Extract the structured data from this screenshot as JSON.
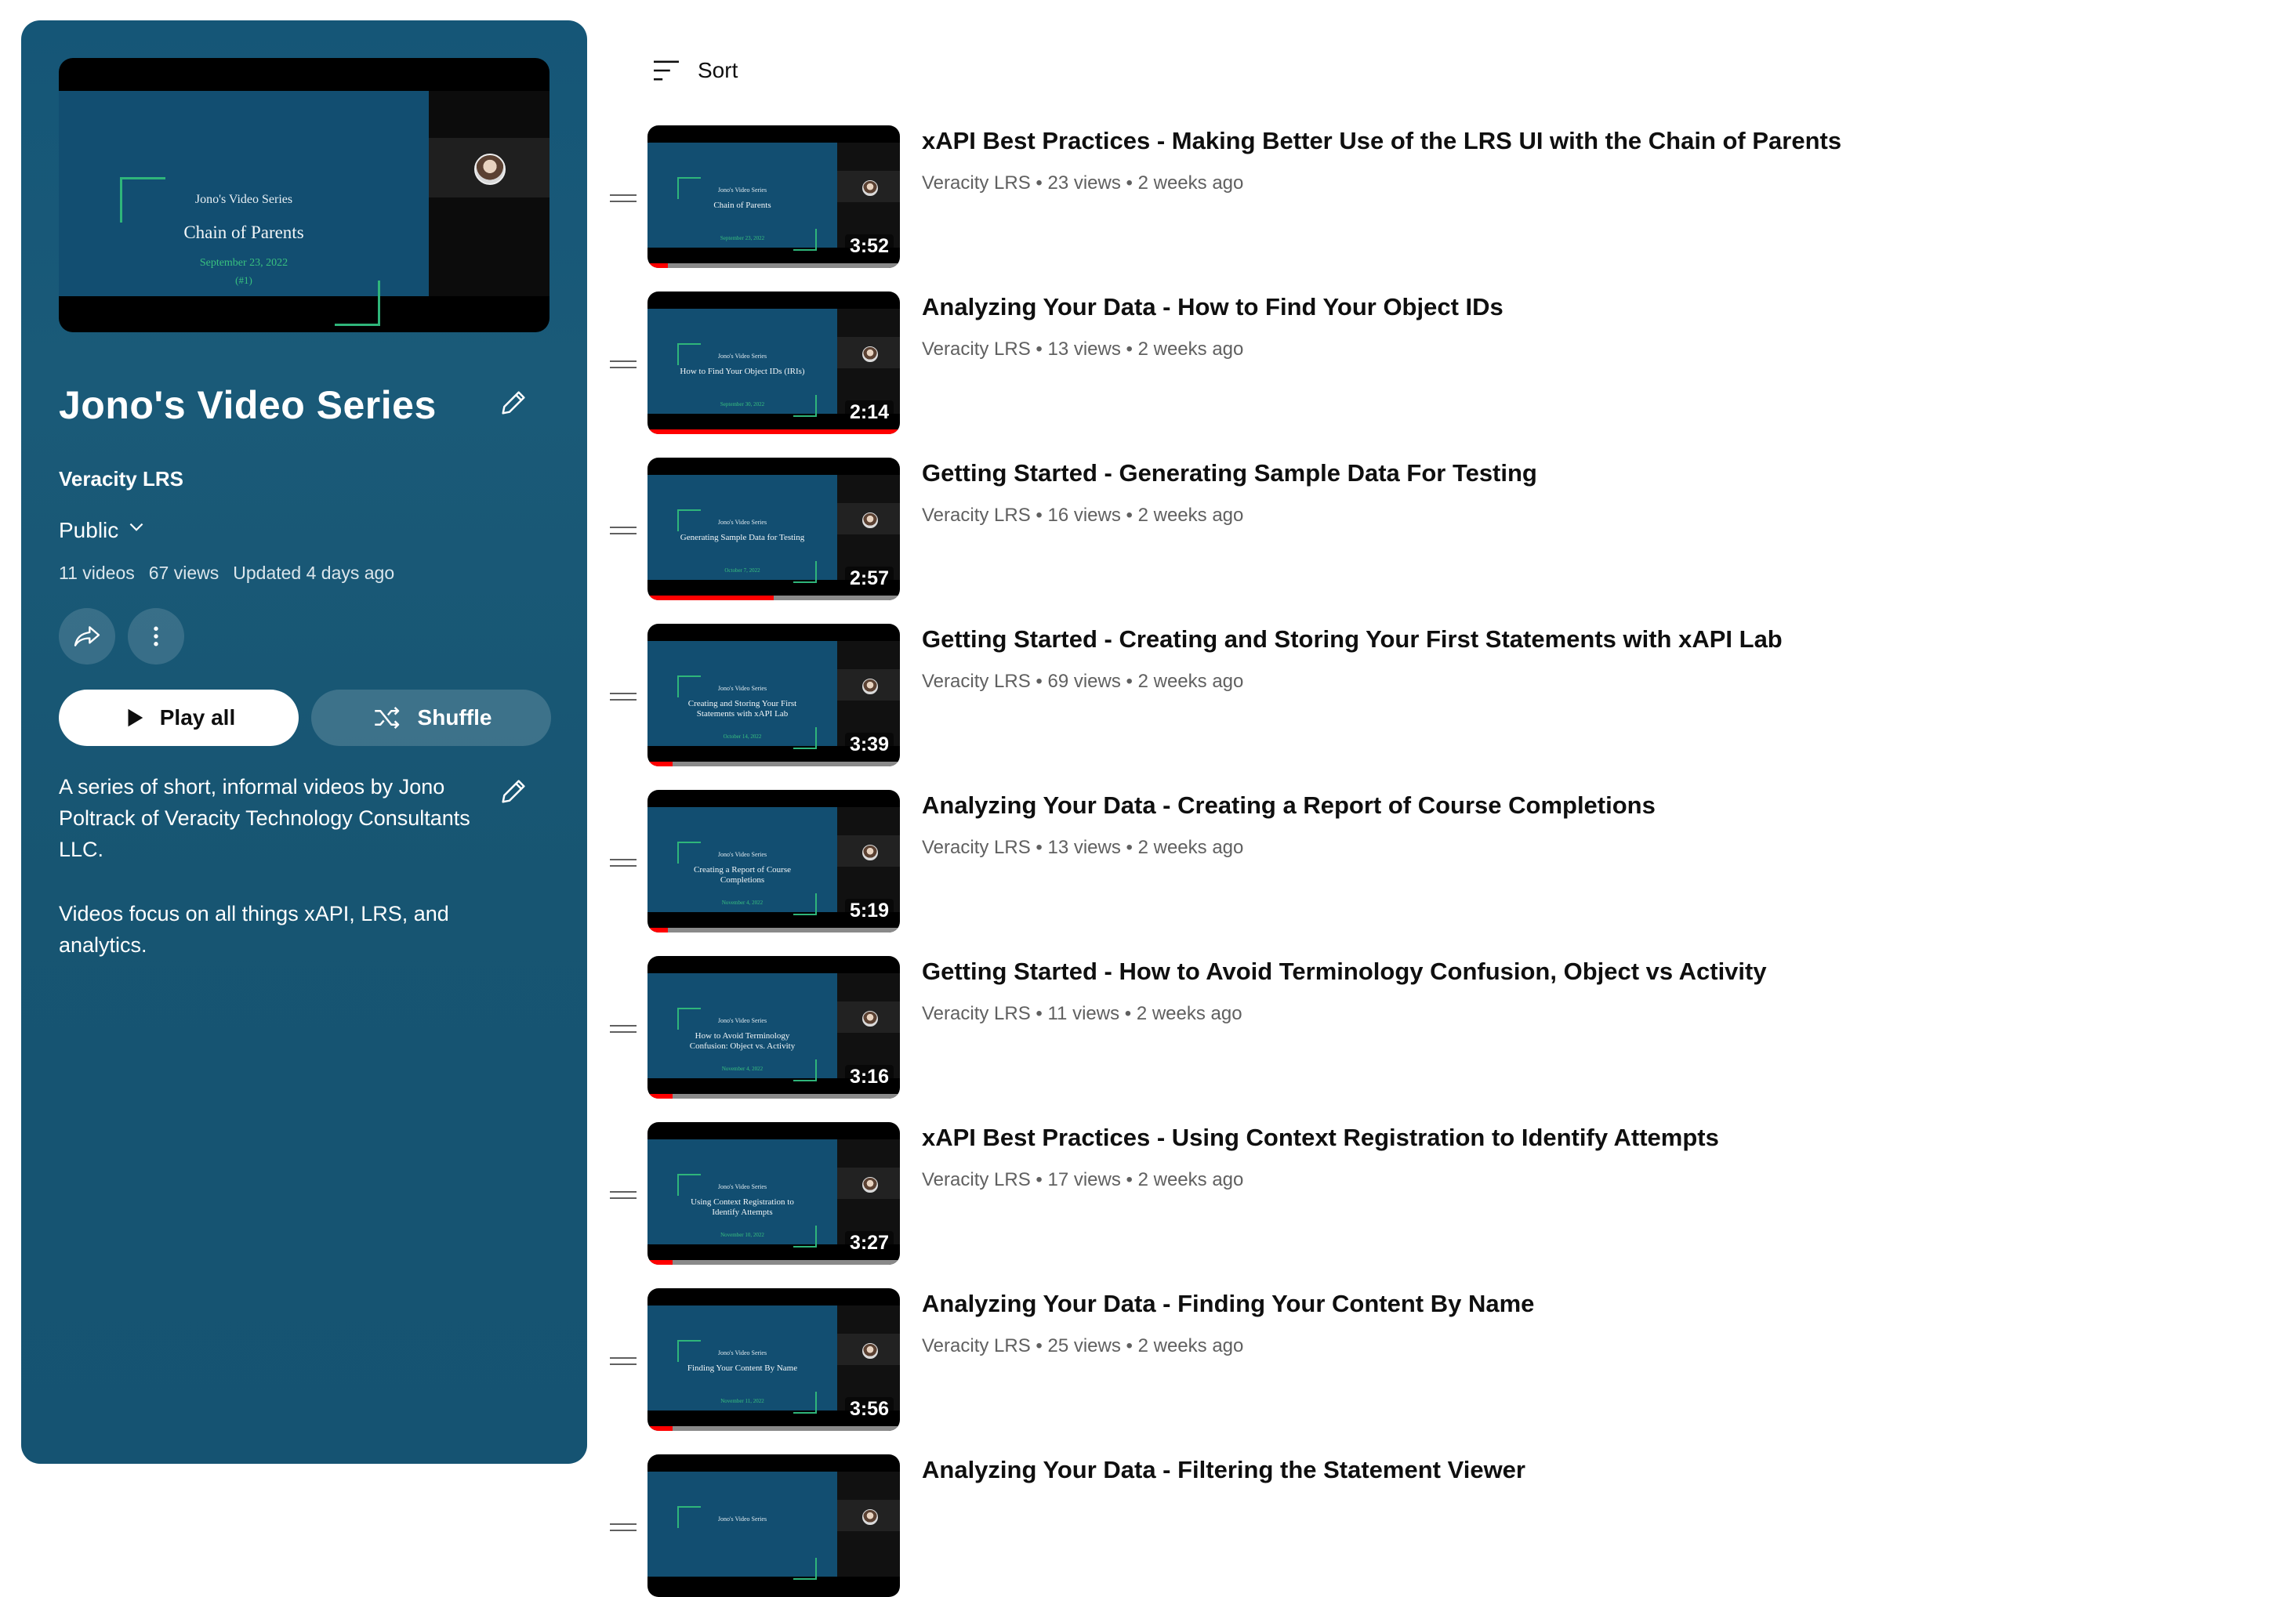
{
  "playlist": {
    "hero": {
      "series": "Jono's Video Series",
      "topic": "Chain of Parents",
      "date": "September 23, 2022",
      "number": "(#1)"
    },
    "title": "Jono's Video Series",
    "channel": "Veracity LRS",
    "privacy": "Public",
    "video_count": "11 videos",
    "views": "67 views",
    "updated": "Updated 4 days ago",
    "play_all_label": "Play all",
    "shuffle_label": "Shuffle",
    "description_1": "A series of short, informal videos by Jono Poltrack of Veracity Technology Consultants LLC.",
    "description_2": "Videos focus on all things xAPI, LRS, and analytics."
  },
  "sort_label": "Sort",
  "thumb_series": "Jono's Video Series",
  "videos": [
    {
      "title": "xAPI Best Practices - Making Better Use of the LRS UI with the Chain of Parents",
      "channel": "Veracity LRS",
      "views": "23 views",
      "age": "2 weeks ago",
      "duration": "3:52",
      "thumb_topic": "Chain of Parents",
      "thumb_date": "September 23, 2022",
      "progress": 0.08
    },
    {
      "title": "Analyzing Your Data - How to Find Your Object IDs",
      "channel": "Veracity LRS",
      "views": "13 views",
      "age": "2 weeks ago",
      "duration": "2:14",
      "thumb_topic": "How to Find Your Object IDs (IRIs)",
      "thumb_date": "September 30, 2022",
      "progress": 1.0
    },
    {
      "title": "Getting Started - Generating Sample Data For Testing",
      "channel": "Veracity LRS",
      "views": "16 views",
      "age": "2 weeks ago",
      "duration": "2:57",
      "thumb_topic": "Generating Sample Data for Testing",
      "thumb_date": "October 7, 2022",
      "progress": 0.5
    },
    {
      "title": "Getting Started - Creating and Storing Your First Statements with xAPI Lab",
      "channel": "Veracity LRS",
      "views": "69 views",
      "age": "2 weeks ago",
      "duration": "3:39",
      "thumb_topic": "Creating and Storing Your First Statements with xAPI Lab",
      "thumb_date": "October 14, 2022",
      "progress": 0.1
    },
    {
      "title": "Analyzing Your Data - Creating a Report of Course Completions",
      "channel": "Veracity LRS",
      "views": "13 views",
      "age": "2 weeks ago",
      "duration": "5:19",
      "thumb_topic": "Creating a Report of Course Completions",
      "thumb_date": "November 4, 2022",
      "progress": 0.08
    },
    {
      "title": "Getting Started - How to Avoid Terminology Confusion, Object vs Activity",
      "channel": "Veracity LRS",
      "views": "11 views",
      "age": "2 weeks ago",
      "duration": "3:16",
      "thumb_topic": "How to Avoid Terminology Confusion: Object vs. Activity",
      "thumb_date": "November 4, 2022",
      "progress": 0.1
    },
    {
      "title": "xAPI Best Practices - Using Context Registration to Identify Attempts",
      "channel": "Veracity LRS",
      "views": "17 views",
      "age": "2 weeks ago",
      "duration": "3:27",
      "thumb_topic": "Using Context Registration to Identify Attempts",
      "thumb_date": "November 10, 2022",
      "progress": 0.1
    },
    {
      "title": "Analyzing Your Data - Finding Your Content By Name",
      "channel": "Veracity LRS",
      "views": "25 views",
      "age": "2 weeks ago",
      "duration": "3:56",
      "thumb_topic": "Finding Your Content By Name",
      "thumb_date": "November 11, 2022",
      "progress": 0.1
    },
    {
      "title": "Analyzing Your Data - Filtering the Statement Viewer",
      "channel": "Veracity LRS",
      "views": "",
      "age": "",
      "duration": "",
      "thumb_topic": "",
      "thumb_date": "",
      "progress": 0
    }
  ],
  "colors": {
    "panel_bg": "#155677",
    "progress": "#ff0000",
    "meta_text": "#606060"
  }
}
